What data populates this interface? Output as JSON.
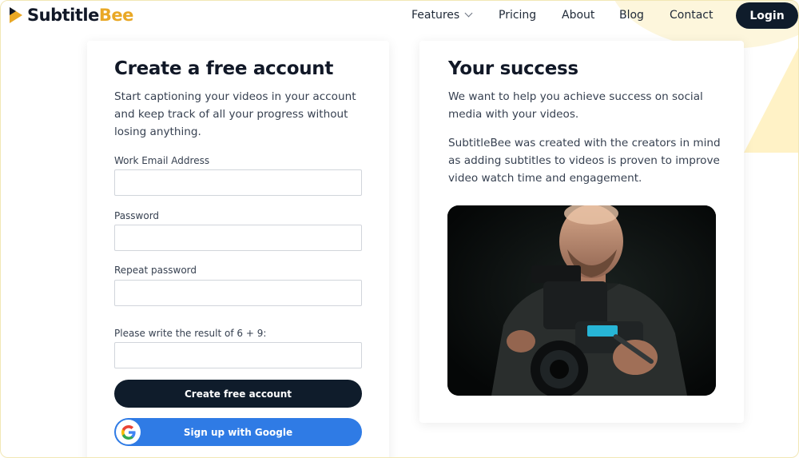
{
  "header": {
    "logo": {
      "part1": "Subtitle",
      "part2": "Bee"
    },
    "nav": [
      {
        "label": "Features"
      },
      {
        "label": "Pricing"
      },
      {
        "label": "About"
      },
      {
        "label": "Blog"
      },
      {
        "label": "Contact"
      }
    ],
    "login_label": "Login"
  },
  "signup": {
    "title": "Create a free account",
    "intro": "Start captioning your videos in your account and keep track of all your progress without losing anything.",
    "email_label": "Work Email Address",
    "email_value": "",
    "password_label": "Password",
    "password_value": "",
    "repeat_label": "Repeat password",
    "repeat_value": "",
    "captcha_label": "Please write the result of 6 + 9:",
    "captcha_value": "",
    "create_label": "Create free account",
    "google_label": "Sign up with Google"
  },
  "success": {
    "title": "Your success",
    "p1": "We want to help you achieve success on social media with your videos.",
    "p2": "SubtitleBee was created with the creators in mind as adding subtitles to videos is proven to improve video watch time and engagement."
  },
  "colors": {
    "brand_dark": "#0f1c2b",
    "brand_yellow": "#e9a826",
    "google_blue": "#2f7be5"
  }
}
